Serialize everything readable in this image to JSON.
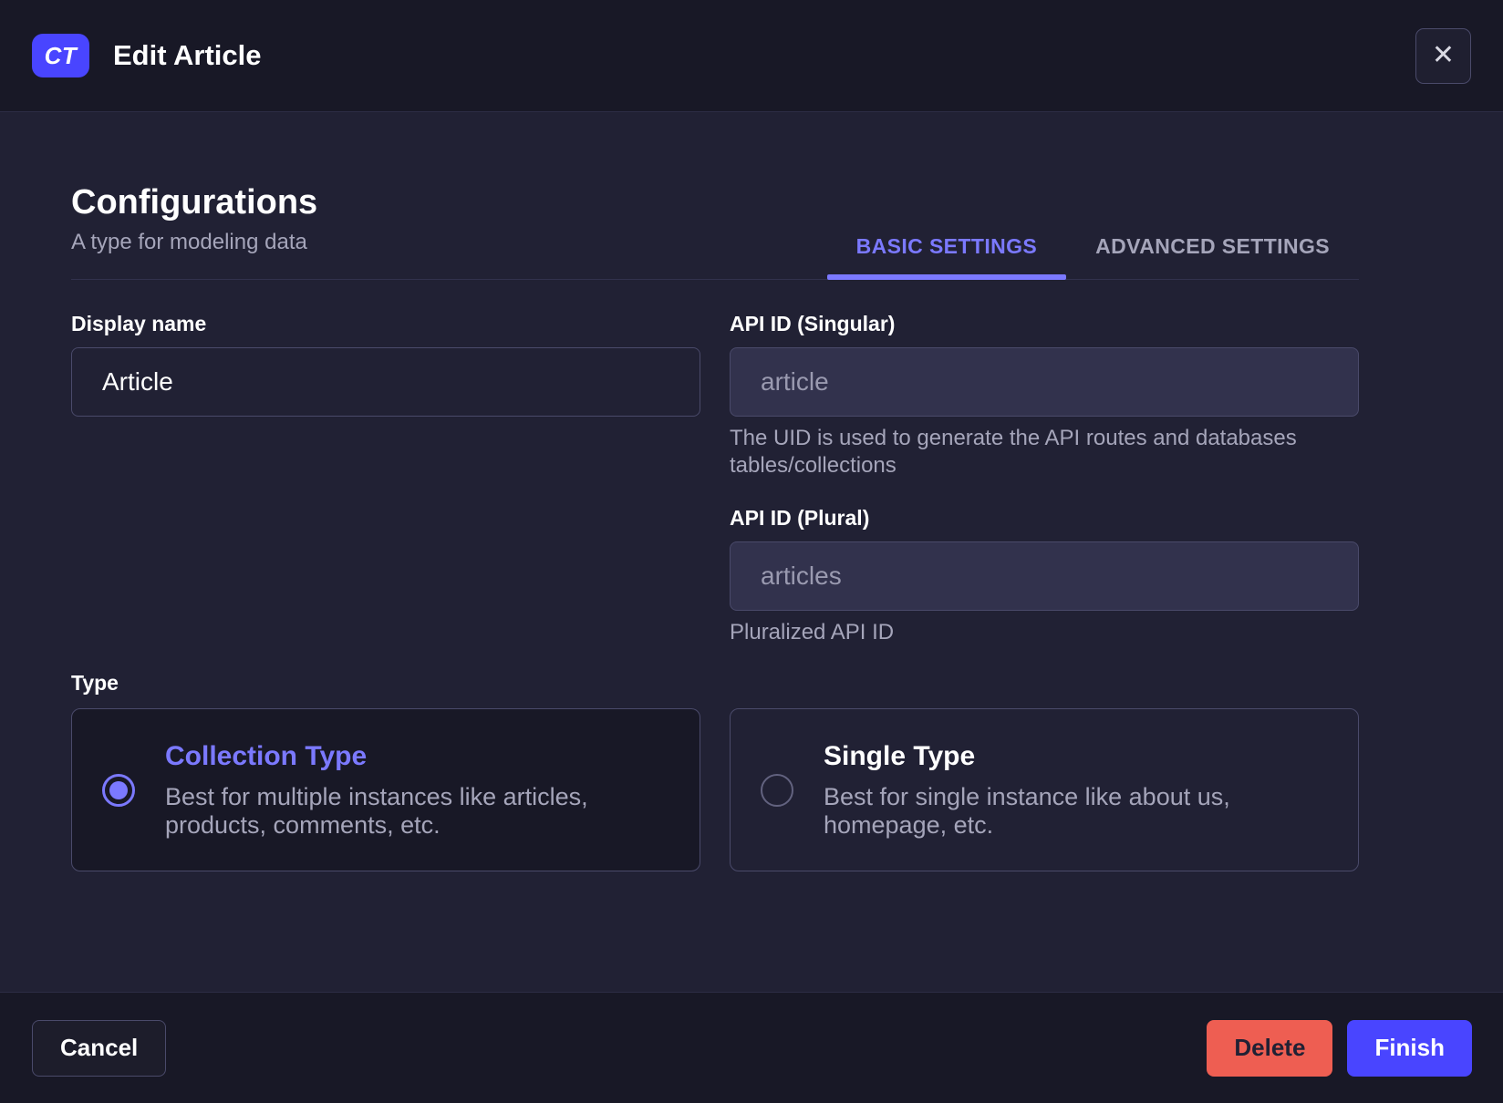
{
  "header": {
    "badge": "CT",
    "title": "Edit Article",
    "close_icon": "✕"
  },
  "section": {
    "title": "Configurations",
    "subtitle": "A type for modeling data",
    "tabs": [
      {
        "label": "BASIC SETTINGS",
        "active": true
      },
      {
        "label": "ADVANCED SETTINGS",
        "active": false
      }
    ]
  },
  "form": {
    "display_name": {
      "label": "Display name",
      "value": "Article"
    },
    "api_id_singular": {
      "label": "API ID (Singular)",
      "placeholder": "article",
      "help": "The UID is used to generate the API routes and databases tables/collections"
    },
    "api_id_plural": {
      "label": "API ID (Plural)",
      "placeholder": "articles",
      "help": "Pluralized API ID"
    },
    "type": {
      "label": "Type",
      "options": [
        {
          "title": "Collection Type",
          "description": "Best for multiple instances like articles, products, comments, etc.",
          "selected": true
        },
        {
          "title": "Single Type",
          "description": "Best for single instance like about us, homepage, etc.",
          "selected": false
        }
      ]
    }
  },
  "footer": {
    "cancel_label": "Cancel",
    "delete_label": "Delete",
    "finish_label": "Finish"
  },
  "colors": {
    "primary": "#4945ff",
    "primary_light": "#7b79ff",
    "danger": "#ee5e52",
    "surface_dark": "#181826",
    "surface": "#212134"
  }
}
